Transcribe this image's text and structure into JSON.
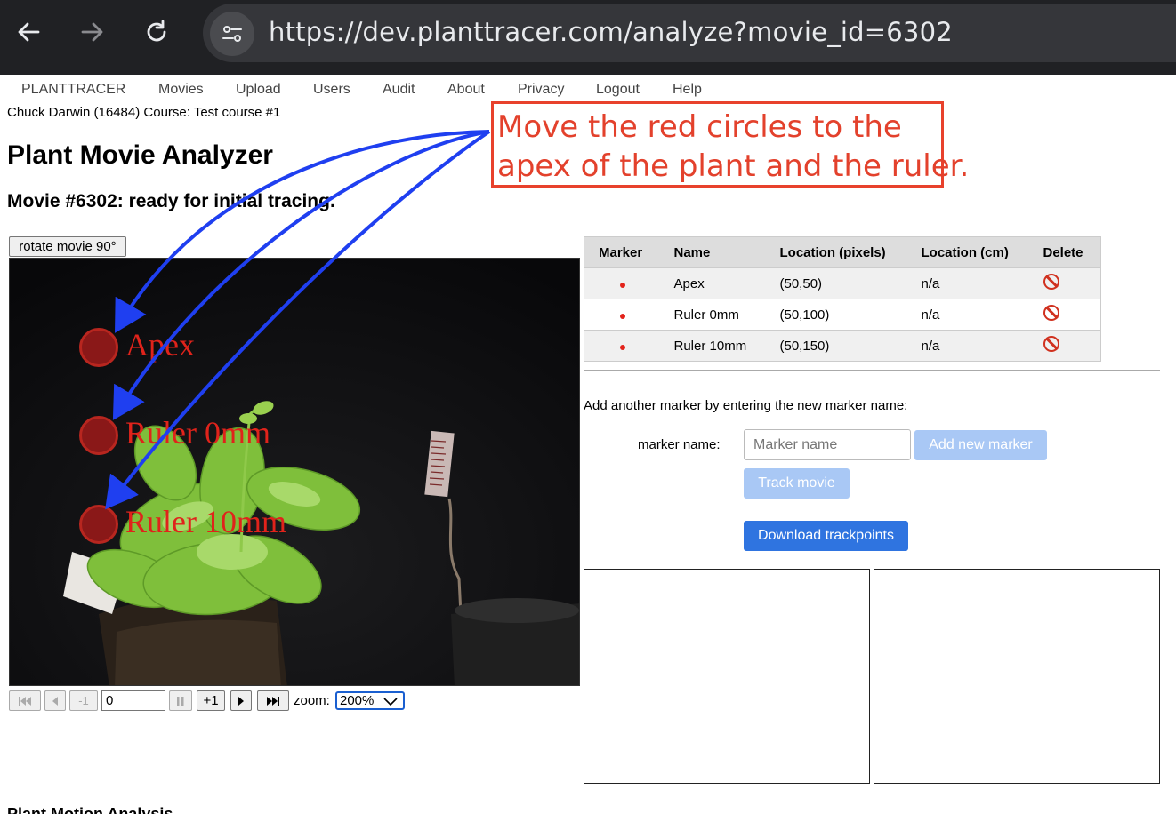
{
  "browser": {
    "url": "https://dev.planttracer.com/analyze?movie_id=6302"
  },
  "nav": {
    "items": [
      "PLANTTRACER",
      "Movies",
      "Upload",
      "Users",
      "Audit",
      "About",
      "Privacy",
      "Logout",
      "Help"
    ]
  },
  "user_line": "Chuck Darwin (16484) Course: Test course #1",
  "page_title": "Plant Movie Analyzer",
  "movie_status": "Movie #6302: ready for initial tracing.",
  "callout": {
    "line1": "Move the red circles to the",
    "line2": "apex of the plant and the ruler."
  },
  "rotate_label": "rotate movie 90°",
  "movie_markers": [
    {
      "label": "Apex"
    },
    {
      "label": "Ruler 0mm"
    },
    {
      "label": "Ruler 10mm"
    }
  ],
  "controls": {
    "minus1": "-1",
    "plus1": "+1",
    "frame_value": "0",
    "zoom_label": "zoom:",
    "zoom_value": "200%"
  },
  "table": {
    "headers": [
      "Marker",
      "Name",
      "Location (pixels)",
      "Location (cm)",
      "Delete"
    ],
    "rows": [
      {
        "name": "Apex",
        "px": "(50,50)",
        "cm": "n/a"
      },
      {
        "name": "Ruler 0mm",
        "px": "(50,100)",
        "cm": "n/a"
      },
      {
        "name": "Ruler 10mm",
        "px": "(50,150)",
        "cm": "n/a"
      }
    ]
  },
  "add_marker": {
    "prompt": "Add another marker by entering the new marker name:",
    "label": "marker name:",
    "placeholder": "Marker name",
    "add_button": "Add new marker",
    "track_button": "Track movie",
    "download_button": "Download trackpoints"
  },
  "footer_heading": "Plant Motion Analysis",
  "colors": {
    "marker_red": "#e0231b",
    "arrow_blue": "#1f3ff0",
    "primary_button": "#2f74e0"
  }
}
